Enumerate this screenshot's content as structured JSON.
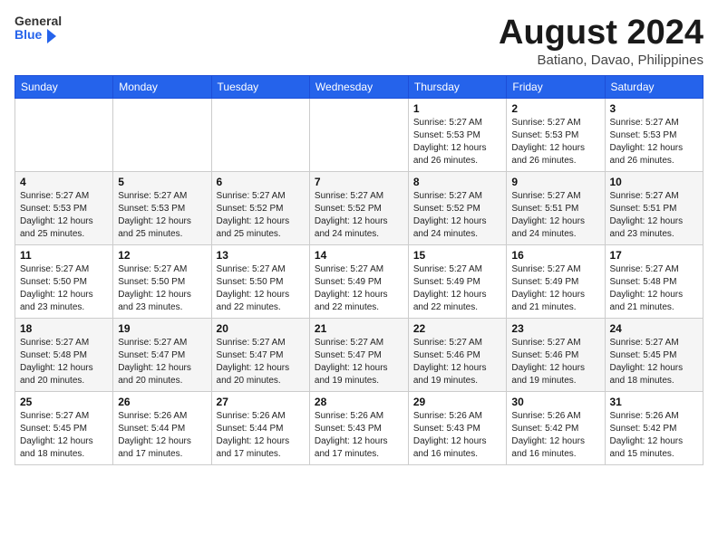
{
  "logo": {
    "general": "General",
    "blue": "Blue"
  },
  "header": {
    "month": "August 2024",
    "location": "Batiano, Davao, Philippines"
  },
  "weekdays": [
    "Sunday",
    "Monday",
    "Tuesday",
    "Wednesday",
    "Thursday",
    "Friday",
    "Saturday"
  ],
  "weeks": [
    [
      {
        "day": "",
        "info": ""
      },
      {
        "day": "",
        "info": ""
      },
      {
        "day": "",
        "info": ""
      },
      {
        "day": "",
        "info": ""
      },
      {
        "day": "1",
        "info": "Sunrise: 5:27 AM\nSunset: 5:53 PM\nDaylight: 12 hours and 26 minutes."
      },
      {
        "day": "2",
        "info": "Sunrise: 5:27 AM\nSunset: 5:53 PM\nDaylight: 12 hours and 26 minutes."
      },
      {
        "day": "3",
        "info": "Sunrise: 5:27 AM\nSunset: 5:53 PM\nDaylight: 12 hours and 26 minutes."
      }
    ],
    [
      {
        "day": "4",
        "info": "Sunrise: 5:27 AM\nSunset: 5:53 PM\nDaylight: 12 hours and 25 minutes."
      },
      {
        "day": "5",
        "info": "Sunrise: 5:27 AM\nSunset: 5:53 PM\nDaylight: 12 hours and 25 minutes."
      },
      {
        "day": "6",
        "info": "Sunrise: 5:27 AM\nSunset: 5:52 PM\nDaylight: 12 hours and 25 minutes."
      },
      {
        "day": "7",
        "info": "Sunrise: 5:27 AM\nSunset: 5:52 PM\nDaylight: 12 hours and 24 minutes."
      },
      {
        "day": "8",
        "info": "Sunrise: 5:27 AM\nSunset: 5:52 PM\nDaylight: 12 hours and 24 minutes."
      },
      {
        "day": "9",
        "info": "Sunrise: 5:27 AM\nSunset: 5:51 PM\nDaylight: 12 hours and 24 minutes."
      },
      {
        "day": "10",
        "info": "Sunrise: 5:27 AM\nSunset: 5:51 PM\nDaylight: 12 hours and 23 minutes."
      }
    ],
    [
      {
        "day": "11",
        "info": "Sunrise: 5:27 AM\nSunset: 5:50 PM\nDaylight: 12 hours and 23 minutes."
      },
      {
        "day": "12",
        "info": "Sunrise: 5:27 AM\nSunset: 5:50 PM\nDaylight: 12 hours and 23 minutes."
      },
      {
        "day": "13",
        "info": "Sunrise: 5:27 AM\nSunset: 5:50 PM\nDaylight: 12 hours and 22 minutes."
      },
      {
        "day": "14",
        "info": "Sunrise: 5:27 AM\nSunset: 5:49 PM\nDaylight: 12 hours and 22 minutes."
      },
      {
        "day": "15",
        "info": "Sunrise: 5:27 AM\nSunset: 5:49 PM\nDaylight: 12 hours and 22 minutes."
      },
      {
        "day": "16",
        "info": "Sunrise: 5:27 AM\nSunset: 5:49 PM\nDaylight: 12 hours and 21 minutes."
      },
      {
        "day": "17",
        "info": "Sunrise: 5:27 AM\nSunset: 5:48 PM\nDaylight: 12 hours and 21 minutes."
      }
    ],
    [
      {
        "day": "18",
        "info": "Sunrise: 5:27 AM\nSunset: 5:48 PM\nDaylight: 12 hours and 20 minutes."
      },
      {
        "day": "19",
        "info": "Sunrise: 5:27 AM\nSunset: 5:47 PM\nDaylight: 12 hours and 20 minutes."
      },
      {
        "day": "20",
        "info": "Sunrise: 5:27 AM\nSunset: 5:47 PM\nDaylight: 12 hours and 20 minutes."
      },
      {
        "day": "21",
        "info": "Sunrise: 5:27 AM\nSunset: 5:47 PM\nDaylight: 12 hours and 19 minutes."
      },
      {
        "day": "22",
        "info": "Sunrise: 5:27 AM\nSunset: 5:46 PM\nDaylight: 12 hours and 19 minutes."
      },
      {
        "day": "23",
        "info": "Sunrise: 5:27 AM\nSunset: 5:46 PM\nDaylight: 12 hours and 19 minutes."
      },
      {
        "day": "24",
        "info": "Sunrise: 5:27 AM\nSunset: 5:45 PM\nDaylight: 12 hours and 18 minutes."
      }
    ],
    [
      {
        "day": "25",
        "info": "Sunrise: 5:27 AM\nSunset: 5:45 PM\nDaylight: 12 hours and 18 minutes."
      },
      {
        "day": "26",
        "info": "Sunrise: 5:26 AM\nSunset: 5:44 PM\nDaylight: 12 hours and 17 minutes."
      },
      {
        "day": "27",
        "info": "Sunrise: 5:26 AM\nSunset: 5:44 PM\nDaylight: 12 hours and 17 minutes."
      },
      {
        "day": "28",
        "info": "Sunrise: 5:26 AM\nSunset: 5:43 PM\nDaylight: 12 hours and 17 minutes."
      },
      {
        "day": "29",
        "info": "Sunrise: 5:26 AM\nSunset: 5:43 PM\nDaylight: 12 hours and 16 minutes."
      },
      {
        "day": "30",
        "info": "Sunrise: 5:26 AM\nSunset: 5:42 PM\nDaylight: 12 hours and 16 minutes."
      },
      {
        "day": "31",
        "info": "Sunrise: 5:26 AM\nSunset: 5:42 PM\nDaylight: 12 hours and 15 minutes."
      }
    ]
  ]
}
